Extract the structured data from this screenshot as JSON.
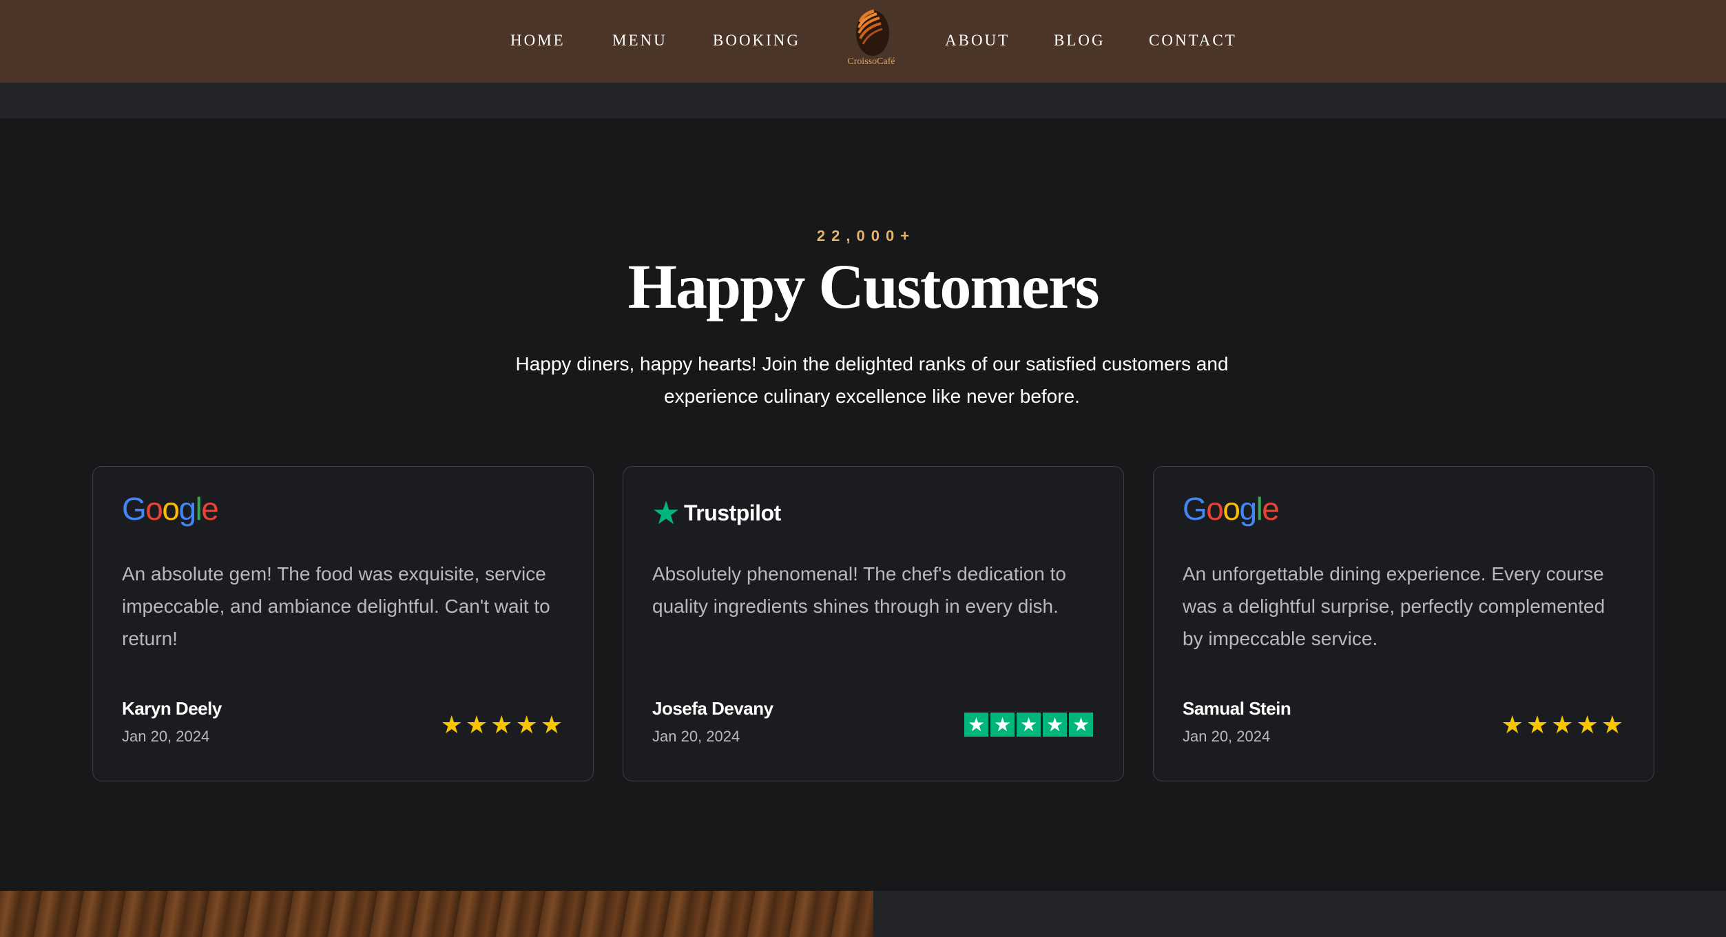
{
  "nav": {
    "left_items": [
      {
        "label": "HOME"
      },
      {
        "label": "MENU"
      },
      {
        "label": "BOOKING"
      }
    ],
    "right_items": [
      {
        "label": "ABOUT"
      },
      {
        "label": "BLOG"
      },
      {
        "label": "CONTACT"
      }
    ],
    "logo_text": "CroissoCafé"
  },
  "section": {
    "eyebrow": "22,000+",
    "title": "Happy Customers",
    "subtitle": "Happy diners, happy hearts! Join the delighted ranks of our satisfied customers and experience culinary excellence like never before."
  },
  "reviews": [
    {
      "source": "Google",
      "text": "An absolute gem! The food was exquisite, service impeccable, and ambiance delightful. Can't wait to return!",
      "name": "Karyn Deely",
      "date": "Jan 20, 2024",
      "rating": 5
    },
    {
      "source": "Trustpilot",
      "text": "Absolutely phenomenal! The chef's dedication to quality ingredients shines through in every dish.",
      "name": "Josefa Devany",
      "date": "Jan 20, 2024",
      "rating": 5
    },
    {
      "source": "Google",
      "text": "An unforgettable dining experience. Every course was a delightful surprise, perfectly complemented by impeccable service.",
      "name": "Samual Stein",
      "date": "Jan 20, 2024",
      "rating": 5
    }
  ],
  "icons": {
    "logo": "croissant-logo-icon",
    "review_star": "star-icon",
    "trustpilot_star": "trustpilot-star-icon"
  },
  "colors": {
    "nav_bg": "#4a3528",
    "page_bg": "#17181a",
    "accent": "#e8b46a",
    "star_yellow": "#f7c600",
    "trustpilot_green": "#00b67a"
  }
}
